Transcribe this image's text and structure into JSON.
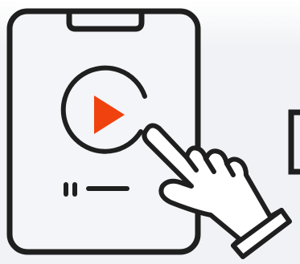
{
  "illustration": {
    "subject": "tablet-play-tap",
    "colors": {
      "background_top": "#ffffff",
      "background_bottom": "#f1f2f5",
      "outline": "#1f1f1f",
      "device_fill": "#f4f5f8",
      "play_accent": "#f0420f",
      "hand_fill": "#ffffff"
    },
    "icons": [
      "tablet-icon",
      "play-button-icon",
      "pointing-hand-icon",
      "progress-bar-icon"
    ]
  }
}
